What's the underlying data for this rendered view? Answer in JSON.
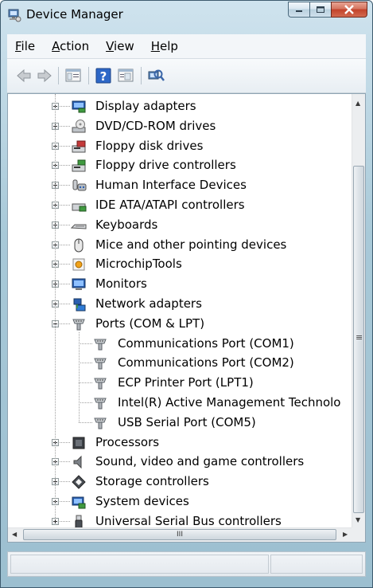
{
  "window": {
    "title": "Device Manager"
  },
  "menu": [
    {
      "pre": "",
      "ul": "F",
      "post": "ile"
    },
    {
      "pre": "",
      "ul": "A",
      "post": "ction"
    },
    {
      "pre": "",
      "ul": "V",
      "post": "iew"
    },
    {
      "pre": "",
      "ul": "H",
      "post": "elp"
    }
  ],
  "tree": {
    "categories": [
      {
        "label": "Display adapters",
        "icon": "display-adapter-icon"
      },
      {
        "label": "DVD/CD-ROM drives",
        "icon": "dvd-drive-icon"
      },
      {
        "label": "Floppy disk drives",
        "icon": "floppy-drive-icon"
      },
      {
        "label": "Floppy drive controllers",
        "icon": "floppy-controller-icon"
      },
      {
        "label": "Human Interface Devices",
        "icon": "hid-icon"
      },
      {
        "label": "IDE ATA/ATAPI controllers",
        "icon": "ide-controller-icon"
      },
      {
        "label": "Keyboards",
        "icon": "keyboard-icon"
      },
      {
        "label": "Mice and other pointing devices",
        "icon": "mouse-icon"
      },
      {
        "label": "MicrochipTools",
        "icon": "microchip-tools-icon"
      },
      {
        "label": "Monitors",
        "icon": "monitor-icon"
      },
      {
        "label": "Network adapters",
        "icon": "network-adapter-icon"
      },
      {
        "label": "Ports (COM & LPT)",
        "icon": "port-icon",
        "expanded": true,
        "children": [
          {
            "label": "Communications Port (COM1)",
            "icon": "port-icon"
          },
          {
            "label": "Communications Port (COM2)",
            "icon": "port-icon"
          },
          {
            "label": "ECP Printer Port (LPT1)",
            "icon": "port-icon"
          },
          {
            "label": "Intel(R) Active Management Technolo",
            "icon": "port-icon"
          },
          {
            "label": "USB Serial Port (COM5)",
            "icon": "port-icon"
          }
        ]
      },
      {
        "label": "Processors",
        "icon": "processor-icon"
      },
      {
        "label": "Sound, video and game controllers",
        "icon": "sound-icon"
      },
      {
        "label": "Storage controllers",
        "icon": "storage-controller-icon"
      },
      {
        "label": "System devices",
        "icon": "system-devices-icon"
      },
      {
        "label": "Universal Serial Bus controllers",
        "icon": "usb-icon"
      }
    ]
  },
  "scrollbar": {
    "h_grip": "III",
    "v_grip": "≡"
  }
}
